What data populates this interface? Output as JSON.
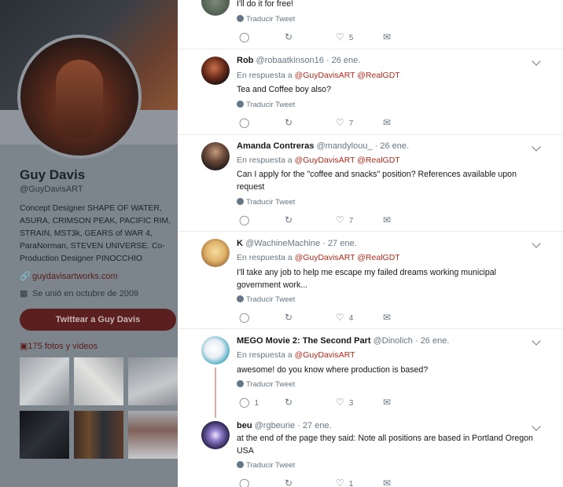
{
  "profile": {
    "name": "Guy Davis",
    "handle": "@GuyDavisART",
    "bio": "Concept Designer SHAPE OF WATER,\nASURA, CRIMSON PEAK, PACIFIC RIM,\nSTRAIN, MST3k, GEARS of WAR 4,\nParaNorman, STEVEN UNIVERSE. Co-\nProduction Designer PINOCCHIO",
    "website": "guydavisartworks.com",
    "joined": "Se unió en octubre de 2009",
    "tweet_button": "Twittear a Guy Davis",
    "media_label": "175 fotos y videos"
  },
  "translate_label": "Traducir Tweet",
  "first_partial": {
    "text": "I'll do it for free!",
    "likes": "5"
  },
  "tweets": [
    {
      "name": "Rob",
      "handle": "@robaatkinson16",
      "date": "· 26 ene.",
      "reply_prefix": "En respuesta a",
      "reply_to": "@GuyDavisART @RealGDT",
      "text": "Tea and Coffee boy also?",
      "replies": "",
      "retweets": "",
      "likes": "7"
    },
    {
      "name": "Amanda Contreras",
      "handle": "@mandylouu_",
      "date": "· 26 ene.",
      "reply_prefix": "En respuesta a",
      "reply_to": "@GuyDavisART @RealGDT",
      "text": "Can I apply for the \"coffee and snacks\" position? References available upon request",
      "replies": "",
      "retweets": "",
      "likes": "7"
    },
    {
      "name": "K",
      "handle": "@WachineMachine",
      "date": "· 27 ene.",
      "reply_prefix": "En respuesta a",
      "reply_to": "@GuyDavisART @RealGDT",
      "text": "I'll take any job to help me escape my failed dreams working municipal government work...",
      "replies": "",
      "retweets": "",
      "likes": "4"
    },
    {
      "name": "MEGO Movie 2: The Second Part",
      "handle": "@Dinolich",
      "date": "· 26 ene.",
      "reply_prefix": "En respuesta a",
      "reply_to": "@GuyDavisART",
      "text": "awesome! do you know where production is based?",
      "replies": "1",
      "retweets": "",
      "likes": "3"
    },
    {
      "name": "beu",
      "handle": "@rgbeurie",
      "date": "· 27 ene.",
      "text": "at the end of the page they said: Note all positions are based in Portland Oregon USA",
      "replies": "",
      "retweets": "",
      "likes": "1"
    }
  ]
}
